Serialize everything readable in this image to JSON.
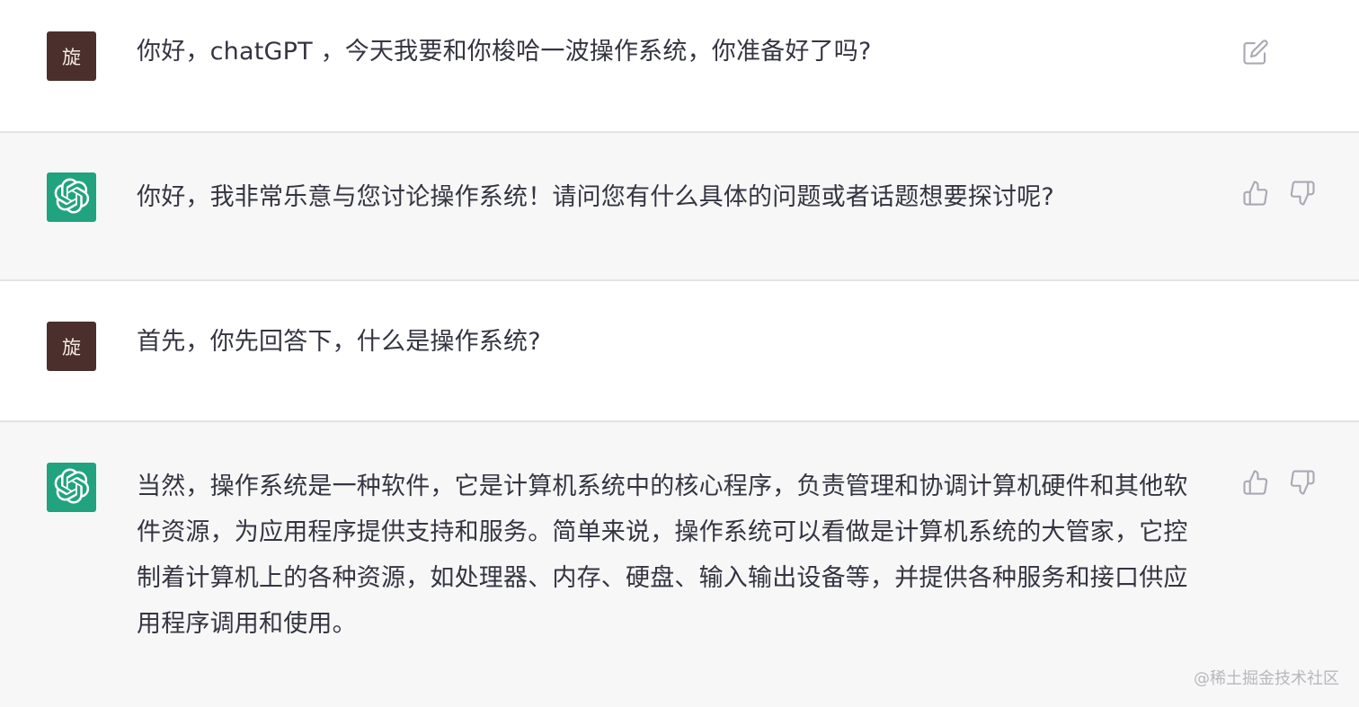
{
  "conversation": {
    "messages": [
      {
        "role": "user",
        "avatar_label": "旋",
        "text": "你好，chatGPT ，今天我要和你梭哈一波操作系统，你准备好了吗?"
      },
      {
        "role": "assistant",
        "text": "你好，我非常乐意与您讨论操作系统！请问您有什么具体的问题或者话题想要探讨呢?"
      },
      {
        "role": "user",
        "avatar_label": "旋",
        "text": "首先，你先回答下，什么是操作系统?"
      },
      {
        "role": "assistant",
        "text": "当然，操作系统是一种软件，它是计算机系统中的核心程序，负责管理和协调计算机硬件和其他软件资源，为应用程序提供支持和服务。简单来说，操作系统可以看做是计算机系统的大管家，它控制着计算机上的各种资源，如处理器、内存、硬盘、输入输出设备等，并提供各种服务和接口供应用程序调用和使用。"
      }
    ]
  },
  "icons": {
    "edit": "edit-icon",
    "thumbs_up": "thumbs-up-icon",
    "thumbs_down": "thumbs-down-icon",
    "assistant_logo": "openai-logo-icon"
  },
  "colors": {
    "user_avatar_bg": "#4a2f2c",
    "assistant_avatar_bg": "#20a37e",
    "assistant_row_bg": "#f7f7f8",
    "user_row_bg": "#ffffff"
  },
  "watermark": "@稀土掘金技术社区"
}
